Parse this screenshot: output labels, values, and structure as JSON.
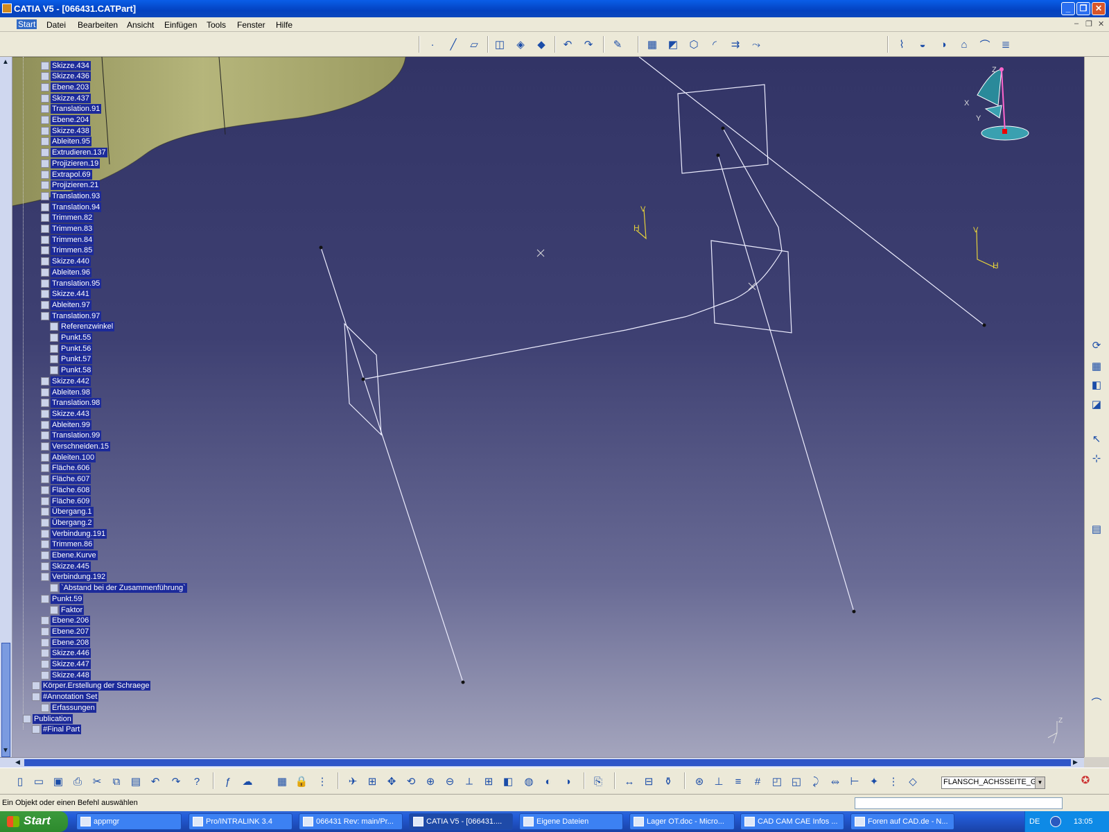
{
  "window": {
    "title": "CATIA V5 - [066431.CATPart]"
  },
  "menu": {
    "items": [
      "Start",
      "Datei",
      "Bearbeiten",
      "Ansicht",
      "Einfügen",
      "Tools",
      "Fenster",
      "Hilfe"
    ]
  },
  "tree": {
    "items": [
      "Skizze.434",
      "Skizze.436",
      "Ebene.203",
      "Skizze.437",
      "Translation.91",
      "Ebene.204",
      "Skizze.438",
      "Ableiten.95",
      "Extrudieren.137",
      "Projizieren.19",
      "Extrapol.69",
      "Projizieren.21",
      "Translation.93",
      "Translation.94",
      "Trimmen.82",
      "Trimmen.83",
      "Trimmen.84",
      "Trimmen.85",
      "Skizze.440",
      "Ableiten.96",
      "Translation.95",
      "Skizze.441",
      "Ableiten.97",
      "Translation.97",
      "Referenzwinkel",
      "Punkt.55",
      "Punkt.56",
      "Punkt.57",
      "Punkt.58",
      "Skizze.442",
      "Ableiten.98",
      "Translation.98",
      "Skizze.443",
      "Ableiten.99",
      "Translation.99",
      "Verschneiden.15",
      "Ableiten.100",
      "Fläche.606",
      "Fläche.607",
      "Fläche.608",
      "Fläche.609",
      "Übergang.1",
      "Übergang.2",
      "Verbindung.191",
      "Trimmen.86",
      "Ebene.Kurve",
      "Skizze.445",
      "Verbindung.192",
      "`Abstand bei der Zusammenführung`",
      "Punkt.59",
      "Faktor",
      "Ebene.206",
      "Ebene.207",
      "Ebene.208",
      "Skizze.446",
      "Skizze.447",
      "Skizze.448",
      "Körper.Erstellung der Schraege",
      "#Annotation Set",
      "Erfassungen",
      "Publication",
      "#Final Part"
    ]
  },
  "viewport": {
    "axis_labels": {
      "v": "V",
      "h": "H",
      "x": "X",
      "y": "Y",
      "z": "Z"
    }
  },
  "toolbar": {
    "combo_value": "FLANSCH_ACHSSEITE_GEO"
  },
  "status": {
    "message": "Ein Objekt oder einen Befehl auswählen"
  },
  "taskbar": {
    "start_label": "Start",
    "tasks": [
      "appmgr",
      "Pro/INTRALINK 3.4",
      "066431 Rev: main/Pr...",
      "CATIA V5 - [066431....",
      "Eigene Dateien",
      "Lager OT.doc - Micro...",
      "CAD CAM CAE Infos ...",
      "Foren auf CAD.de - N..."
    ],
    "language": "DE",
    "clock": "13:05"
  },
  "colors": {
    "tree_highlight": "#1c2a9a",
    "viewport_top": "#323466",
    "viewport_bottom": "#a4a5bd",
    "surface": "#a9a96c",
    "wire": "#ffffff",
    "axis": "#e6d23a"
  }
}
